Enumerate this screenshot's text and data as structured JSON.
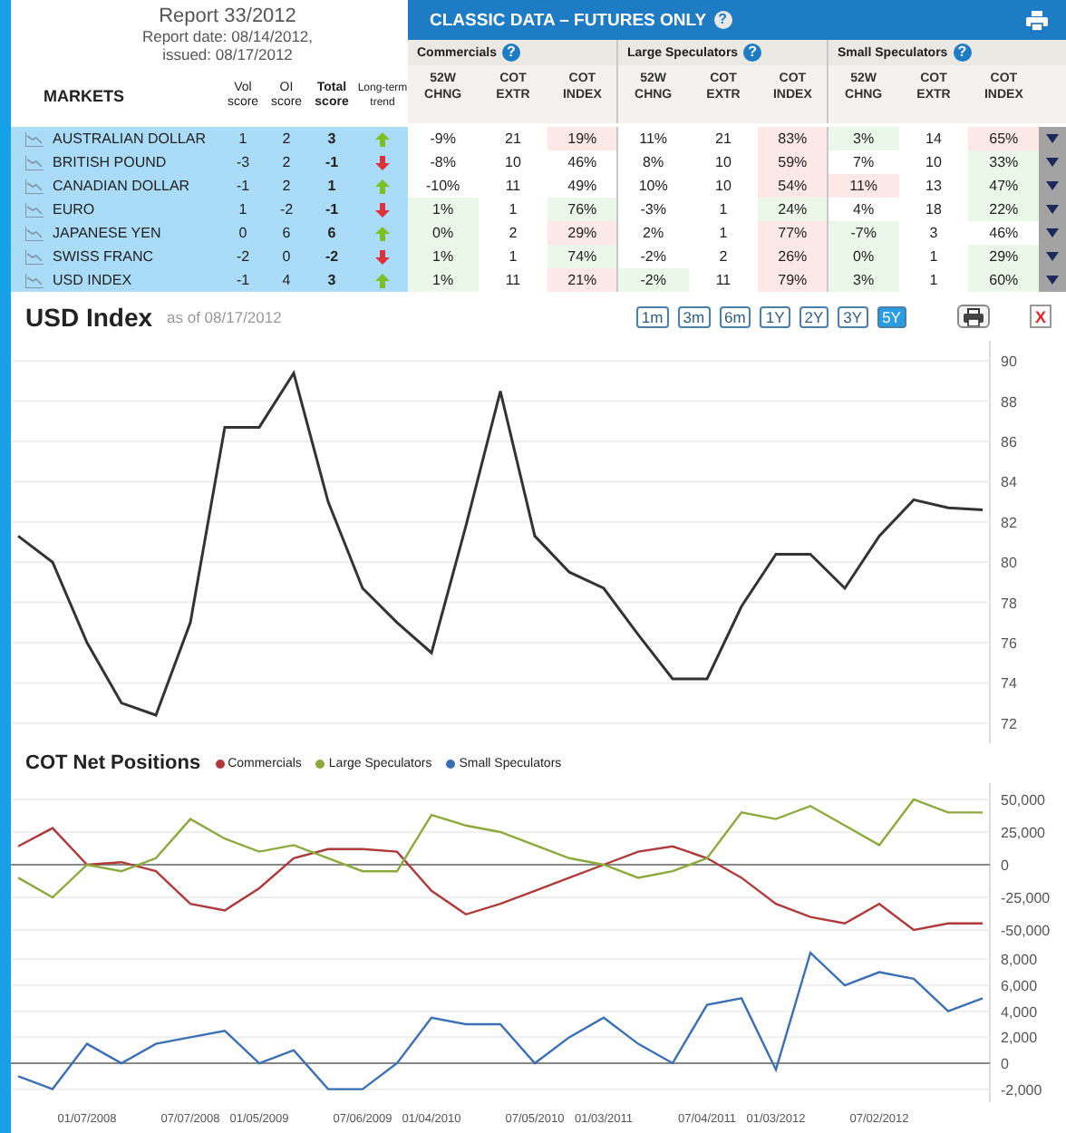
{
  "report": {
    "title": "Report 33/2012",
    "date_line": "Report date: 08/14/2012,",
    "issued_line": "issued: 08/17/2012"
  },
  "left_columns": {
    "markets": "MARKETS",
    "vol": "Vol score",
    "oi": "OI score",
    "total": "Total score",
    "trend": "Long-term trend"
  },
  "classic": {
    "title": "CLASSIC DATA – FUTURES ONLY",
    "help": "?"
  },
  "groups": [
    {
      "name": "Commercials",
      "help": "?"
    },
    {
      "name": "Large Speculators",
      "help": "?"
    },
    {
      "name": "Small Speculators",
      "help": "?"
    }
  ],
  "sub_columns": [
    "52W CHNG",
    "COT EXTR",
    "COT INDEX",
    "52W CHNG",
    "COT EXTR",
    "COT INDEX",
    "52W CHNG",
    "COT EXTR",
    "COT INDEX"
  ],
  "rows": [
    {
      "market": "AUSTRALIAN DOLLAR",
      "vol": "1",
      "oi": "2",
      "total": "3",
      "rising": true,
      "cells": [
        {
          "text": "-9%"
        },
        {
          "text": "21"
        },
        {
          "text": "19%",
          "color": "#fde8e8"
        },
        {
          "text": "11%"
        },
        {
          "text": "21"
        },
        {
          "text": "83%",
          "color": "#fde8e8"
        },
        {
          "text": "3%",
          "color": "#ebf7e8"
        },
        {
          "text": "14"
        },
        {
          "text": "65%",
          "color": "#fde8e8"
        }
      ]
    },
    {
      "market": "BRITISH POUND",
      "vol": "-3",
      "oi": "2",
      "total": "-1",
      "rising": false,
      "cells": [
        {
          "text": "-8%"
        },
        {
          "text": "10"
        },
        {
          "text": "46%"
        },
        {
          "text": "8%"
        },
        {
          "text": "10"
        },
        {
          "text": "59%",
          "color": "#fde8e8"
        },
        {
          "text": "7%"
        },
        {
          "text": "10"
        },
        {
          "text": "33%",
          "color": "#ebf7e8"
        }
      ]
    },
    {
      "market": "CANADIAN DOLLAR",
      "vol": "-1",
      "oi": "2",
      "total": "1",
      "rising": true,
      "cells": [
        {
          "text": "-10%"
        },
        {
          "text": "11"
        },
        {
          "text": "49%"
        },
        {
          "text": "10%"
        },
        {
          "text": "10"
        },
        {
          "text": "54%",
          "color": "#fde8e8"
        },
        {
          "text": "11%",
          "color": "#fde8e8"
        },
        {
          "text": "13"
        },
        {
          "text": "47%",
          "color": "#ebf7e8"
        }
      ]
    },
    {
      "market": "EURO",
      "vol": "1",
      "oi": "-2",
      "total": "-1",
      "rising": false,
      "cells": [
        {
          "text": "1%",
          "color": "#ebf7e8"
        },
        {
          "text": "1"
        },
        {
          "text": "76%",
          "color": "#ebf7e8"
        },
        {
          "text": "-3%"
        },
        {
          "text": "1"
        },
        {
          "text": "24%",
          "color": "#ebf7e8"
        },
        {
          "text": "4%"
        },
        {
          "text": "18"
        },
        {
          "text": "22%",
          "color": "#ebf7e8"
        }
      ]
    },
    {
      "market": "JAPANESE YEN",
      "vol": "0",
      "oi": "6",
      "total": "6",
      "rising": true,
      "cells": [
        {
          "text": "0%",
          "color": "#ebf7e8"
        },
        {
          "text": "2"
        },
        {
          "text": "29%",
          "color": "#fde8e8"
        },
        {
          "text": "2%"
        },
        {
          "text": "1"
        },
        {
          "text": "77%",
          "color": "#fde8e8"
        },
        {
          "text": "-7%",
          "color": "#ebf7e8"
        },
        {
          "text": "3"
        },
        {
          "text": "46%"
        }
      ]
    },
    {
      "market": "SWISS FRANC",
      "vol": "-2",
      "oi": "0",
      "total": "-2",
      "rising": false,
      "cells": [
        {
          "text": "1%",
          "color": "#ebf7e8"
        },
        {
          "text": "1"
        },
        {
          "text": "74%",
          "color": "#ebf7e8"
        },
        {
          "text": "-2%"
        },
        {
          "text": "2"
        },
        {
          "text": "26%",
          "color": "#fde8e8"
        },
        {
          "text": "0%",
          "color": "#ebf7e8"
        },
        {
          "text": "1"
        },
        {
          "text": "29%",
          "color": "#ebf7e8"
        }
      ]
    },
    {
      "market": "USD INDEX",
      "vol": "-1",
      "oi": "4",
      "total": "3",
      "rising": true,
      "cells": [
        {
          "text": "1%",
          "color": "#ebf7e8"
        },
        {
          "text": "11"
        },
        {
          "text": "21%",
          "color": "#fde8e8"
        },
        {
          "text": "-2%",
          "color": "#ebf7e8"
        },
        {
          "text": "11"
        },
        {
          "text": "79%",
          "color": "#fde8e8"
        },
        {
          "text": "3%",
          "color": "#ebf7e8"
        },
        {
          "text": "1"
        },
        {
          "text": "60%",
          "color": "#ebf7e8"
        }
      ]
    }
  ],
  "price": {
    "as_of": "as of 08/17/2012",
    "ranges": [
      {
        "label": "1m",
        "selected": false
      },
      {
        "label": "3m",
        "selected": false
      },
      {
        "label": "6m",
        "selected": false
      },
      {
        "label": "1Y",
        "selected": false
      },
      {
        "label": "2Y",
        "selected": false
      },
      {
        "label": "3Y",
        "selected": false
      },
      {
        "label": "5Y",
        "selected": true
      }
    ],
    "close": "X",
    "chart_data": {
      "type": "line",
      "title": "USD Index",
      "grid": true,
      "ylim": [
        71,
        91
      ],
      "yticks": [
        72,
        74,
        76,
        78,
        80,
        82,
        84,
        86,
        88,
        90
      ],
      "series": [
        {
          "color": "#333333",
          "values": [
            81.3,
            80,
            76,
            73,
            72.4,
            77,
            86.7,
            86.7,
            89.4,
            83,
            78.7,
            77,
            75.5,
            81.8,
            88.5,
            81.3,
            79.5,
            78.7,
            76.4,
            74.2,
            74.2,
            77.8,
            80.4,
            80.4,
            78.7,
            81.3,
            83.1,
            82.7,
            82.6
          ]
        }
      ]
    }
  },
  "cot": {
    "title": "COT Net Positions",
    "top": {
      "chart_data": {
        "type": "line",
        "grid": true,
        "ylim": [
          -62500,
          62500
        ],
        "yticks": [
          {
            "value": 50000,
            "label": "50,000"
          },
          {
            "value": 25000,
            "label": "25,000"
          },
          {
            "value": 0,
            "label": "0"
          },
          {
            "value": -25000,
            "label": "-25,000"
          },
          {
            "value": -50000,
            "label": "-50,000"
          }
        ],
        "series": [
          {
            "name": "Commercials",
            "color": "#b03a3a",
            "values": [
              14000,
              28000,
              0,
              2000,
              -5000,
              -30000,
              -35000,
              -18000,
              5000,
              12000,
              12000,
              10000,
              -20000,
              -38000,
              -30000,
              -20000,
              -10000,
              0,
              10000,
              14000,
              5000,
              -10000,
              -30000,
              -40000,
              -45000,
              -30000,
              -50000,
              -45000,
              -45000
            ]
          },
          {
            "name": "Large Speculators",
            "color": "#8aab3c",
            "values": [
              -10000,
              -25000,
              0,
              -5000,
              5000,
              35000,
              20000,
              10000,
              15000,
              5000,
              -5000,
              -5000,
              38000,
              30000,
              25000,
              15000,
              5000,
              0,
              -10000,
              -5000,
              5000,
              40000,
              35000,
              45000,
              30000,
              15000,
              50000,
              40000,
              40000
            ]
          }
        ]
      }
    },
    "bottom": {
      "chart_data": {
        "type": "line",
        "grid": true,
        "categories": [
          null,
          null,
          "01/07/2008",
          null,
          null,
          "07/07/2008",
          null,
          "01/05/2009",
          null,
          null,
          "07/06/2009",
          null,
          "01/04/2010",
          null,
          null,
          "07/05/2010",
          null,
          "01/03/2011",
          null,
          null,
          "07/04/2011",
          null,
          "01/03/2012",
          null,
          null,
          "07/02/2012",
          null,
          null,
          null
        ],
        "ylim": [
          -3000,
          9000
        ],
        "yticks": [
          {
            "value": 8000,
            "label": "8,000"
          },
          {
            "value": 6000,
            "label": "6,000"
          },
          {
            "value": 4000,
            "label": "4,000"
          },
          {
            "value": 2000,
            "label": "2,000"
          },
          {
            "value": 0,
            "label": "0"
          },
          {
            "value": -2000,
            "label": "-2,000"
          }
        ],
        "series": [
          {
            "name": "Small Speculators",
            "color": "#3a6fb5",
            "values": [
              -1000,
              -2000,
              1500,
              0,
              1500,
              2000,
              2500,
              0,
              1000,
              -2000,
              -2000,
              0,
              3500,
              3000,
              3000,
              0,
              2000,
              3500,
              1500,
              0,
              4500,
              5000,
              -500,
              8500,
              6000,
              7000,
              6500,
              4000,
              5000
            ]
          }
        ]
      }
    }
  }
}
